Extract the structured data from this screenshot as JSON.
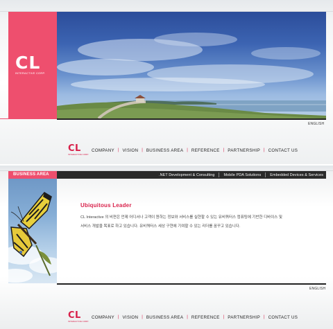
{
  "screen1": {
    "logo": {
      "mark": "CL",
      "sub": "INTERACTIVE CORP."
    },
    "language": "ENGLISH",
    "nav": {
      "logo_mark": "CL",
      "logo_sub": "INTERACTIVE CORP.",
      "items": [
        "COMPANY",
        "VISION",
        "BUSINESS AREA",
        "REFERENCE",
        "PARTNERSHIP",
        "CONTACT US"
      ]
    }
  },
  "screen2": {
    "section_tab": "BUSINESS AREA",
    "subnav": [
      ".NET Development & Consulting",
      "Mobile PDA Solutions",
      "Embedded Devices & Services"
    ],
    "content_title": "Ubiquitous Leader",
    "content_line1": "CL Interactive 의 비젼은 언제 어디서나 고객이 원하는 정보와 서비스를 실현할 수 있는 유비쿼터스 컴퓨팅에 기반한 디바이스 및",
    "content_line2": "서비스 개발을 목표로 하고 있습니다. 유비쿼터스 세상 구현에 기여할 수 있는 리더를 꿈꾸고 있습니다.",
    "language": "ENGLISH",
    "nav": {
      "logo_mark": "CL",
      "logo_sub": "INTERACTIVE CORP.",
      "items": [
        "COMPANY",
        "VISION",
        "BUSINESS AREA",
        "REFERENCE",
        "PARTNERSHIP",
        "CONTACT US"
      ]
    }
  },
  "colors": {
    "accent": "#ee4f6e",
    "accent_text": "#d8204a",
    "dark_bar": "#2a2a2a"
  }
}
